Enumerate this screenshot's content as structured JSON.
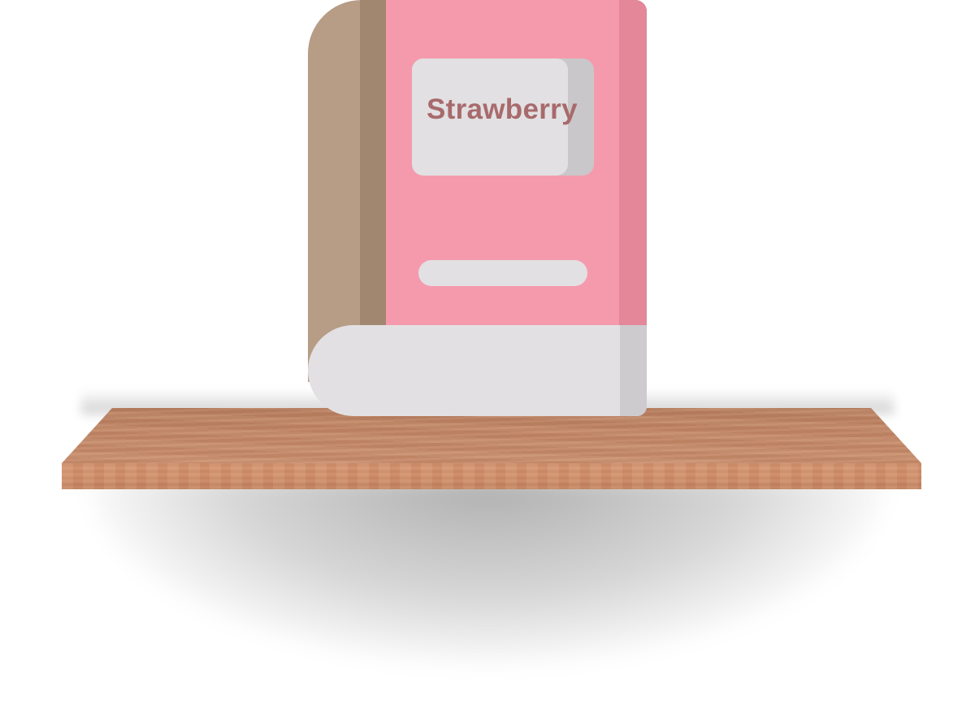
{
  "book": {
    "title": "Strawberry"
  },
  "colors": {
    "background": "#ffffff",
    "book_cover": "#f59aad",
    "book_cover_edge": "#e38799",
    "book_back": "#b79c86",
    "book_spine": "#a28770",
    "label": "#e2e0e2",
    "title_text": "#a86a6c",
    "pages": "#e2e0e2",
    "shelf_wood": "#c98f6e"
  }
}
